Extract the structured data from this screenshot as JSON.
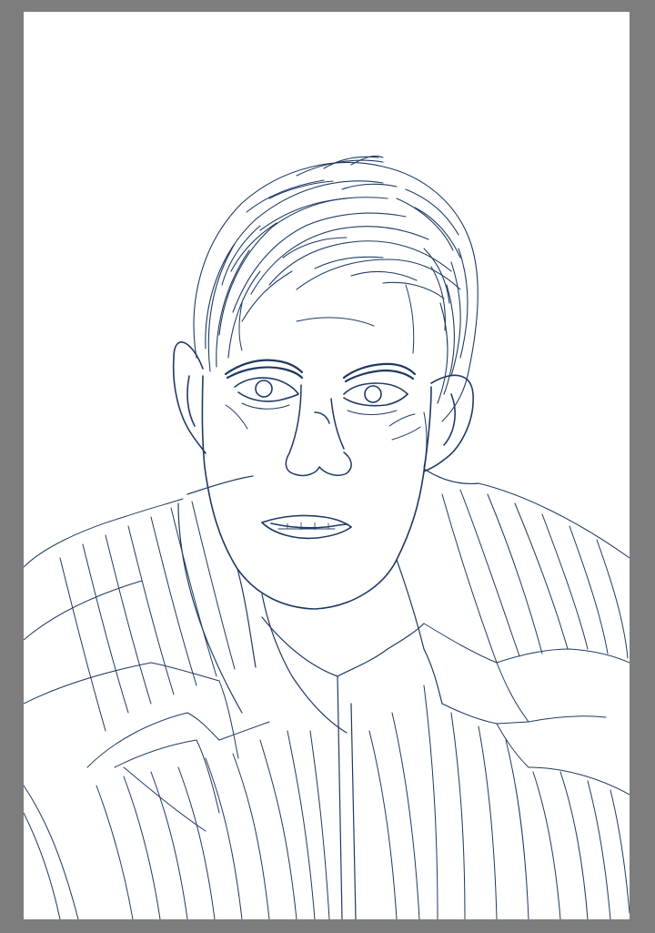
{
  "canvas": {
    "background": "#ffffff",
    "workspace_background": "#7d7d7d",
    "ink_color": "#1f3a63",
    "stubble_color": "#5a6f90"
  }
}
